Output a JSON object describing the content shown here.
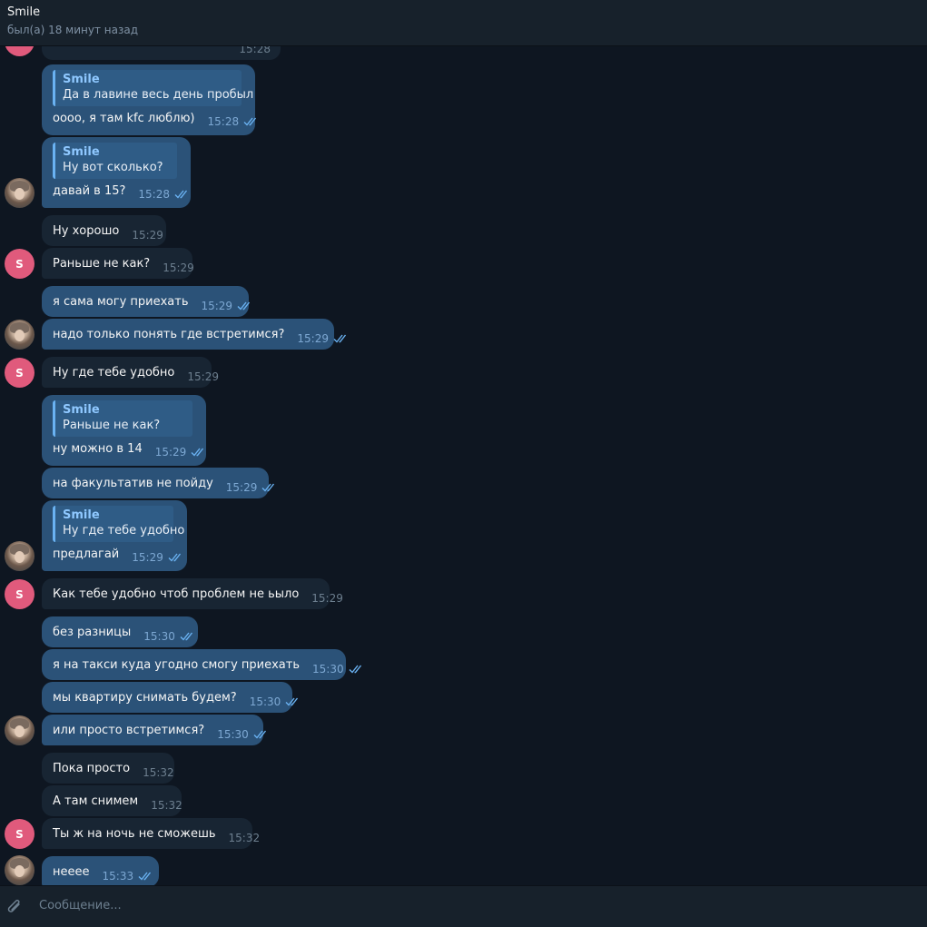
{
  "header": {
    "title": "Smile",
    "status": "был(а) 18 минут назад"
  },
  "partial_top": {
    "time": "15:28"
  },
  "messages": {
    "m1": {
      "reply_name": "Smile",
      "reply_text": "Да в лавине весь день пробыл",
      "text": "оооо, я там kfc люблю)",
      "time": "15:28"
    },
    "m2": {
      "reply_name": "Smile",
      "reply_text": "Ну вот сколько?",
      "text": "давай в 15?",
      "time": "15:28"
    },
    "m3": {
      "text": "Ну хорошо",
      "time": "15:29"
    },
    "m4": {
      "text": "Раньше не как?",
      "time": "15:29"
    },
    "m5": {
      "text": "я сама могу приехать",
      "time": "15:29"
    },
    "m6": {
      "text": "надо только понять где встретимся?",
      "time": "15:29"
    },
    "m7": {
      "text": "Ну где тебе удобно",
      "time": "15:29"
    },
    "m8": {
      "reply_name": "Smile",
      "reply_text": "Раньше не как?",
      "text": "ну можно в 14",
      "time": "15:29"
    },
    "m9": {
      "text": "на факультатив не пойду",
      "time": "15:29"
    },
    "m10": {
      "reply_name": "Smile",
      "reply_text": "Ну где тебе удобно",
      "text": "предлагай",
      "time": "15:29"
    },
    "m11": {
      "text": "Как тебе удобно чтоб проблем не ьыло",
      "time": "15:29"
    },
    "m12": {
      "text": "без разницы",
      "time": "15:30"
    },
    "m13": {
      "text": "я на такси куда угодно смогу приехать",
      "time": "15:30"
    },
    "m14": {
      "text": "мы квартиру снимать будем?",
      "time": "15:30"
    },
    "m15": {
      "text": "или просто встретимся?",
      "time": "15:30"
    },
    "m16": {
      "text": "Пока просто",
      "time": "15:32"
    },
    "m17": {
      "text": "А там снимем",
      "time": "15:32"
    },
    "m18": {
      "text": "Ты ж на ночь не сможешь",
      "time": "15:32"
    },
    "m19": {
      "text": "неeee",
      "time": "15:33"
    }
  },
  "avatar_letter": "S",
  "input": {
    "placeholder": "Сообщение..."
  },
  "colors": {
    "outgoing": "#2b5278",
    "incoming": "#182533",
    "accent": "#6ab2f2",
    "avatar_s": "#e05a7c",
    "background": "#0e1621"
  },
  "icons": {
    "attach": "paperclip-icon",
    "read": "double-check-icon"
  }
}
